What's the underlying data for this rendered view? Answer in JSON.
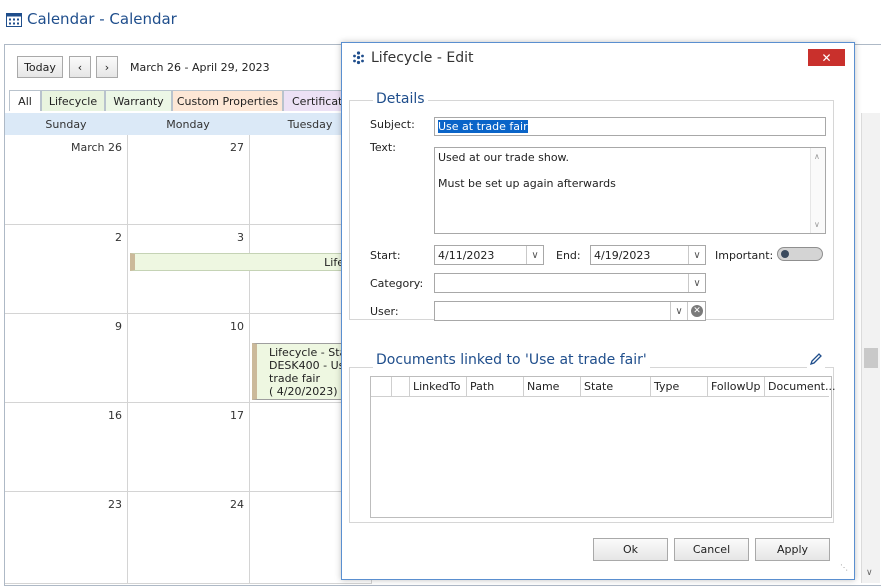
{
  "window": {
    "title": "Calendar - Calendar"
  },
  "toolbar": {
    "today_label": "Today",
    "prev_icon": "chevron-left-icon",
    "next_icon": "chevron-right-icon",
    "date_range": "March 26 - April 29, 2023"
  },
  "tabs": [
    {
      "label": "All",
      "color": "#ffffff"
    },
    {
      "label": "Lifecycle",
      "color": "#e9f4df"
    },
    {
      "label": "Warranty",
      "color": "#ecf7e6"
    },
    {
      "label": "Custom Properties",
      "color": "#fde7d6"
    },
    {
      "label": "Certificate",
      "color": "#ece1f5"
    }
  ],
  "days": [
    "Sunday",
    "Monday",
    "Tuesday"
  ],
  "weeks": [
    [
      "March 26",
      "27",
      ""
    ],
    [
      "2",
      "3",
      ""
    ],
    [
      "9",
      "10",
      ""
    ],
    [
      "16",
      "17",
      ""
    ],
    [
      "23",
      "24",
      ""
    ]
  ],
  "events": {
    "bar_label": "Life",
    "block_lines": [
      "Lifecycle - Star",
      "DESK400 - Use",
      "trade fair",
      "( 4/20/2023)"
    ]
  },
  "dialog": {
    "title": "Lifecycle - Edit",
    "close_icon": "close-icon",
    "details_title": "Details",
    "subject_label": "Subject:",
    "subject_value": "Use at trade fair",
    "text_label": "Text:",
    "text_line1": "Used at our trade show.",
    "text_line2": "Must be set up again afterwards",
    "start_label": "Start:",
    "start_value": "4/11/2023",
    "end_label": "End:",
    "end_value": "4/19/2023",
    "important_label": "Important:",
    "category_label": "Category:",
    "category_value": "",
    "user_label": "User:",
    "user_value": "",
    "docs_title": "Documents linked to 'Use at trade fair'",
    "columns": [
      "",
      "LinkedTo",
      "Path",
      "Name",
      "State",
      "Type",
      "FollowUp",
      "Document..."
    ],
    "ok_label": "Ok",
    "cancel_label": "Cancel",
    "apply_label": "Apply"
  },
  "colors": {
    "accent": "#1f4e8c",
    "selection": "#0a64c8",
    "close_button": "#c9302c",
    "event_bar": "#eef7e1"
  }
}
